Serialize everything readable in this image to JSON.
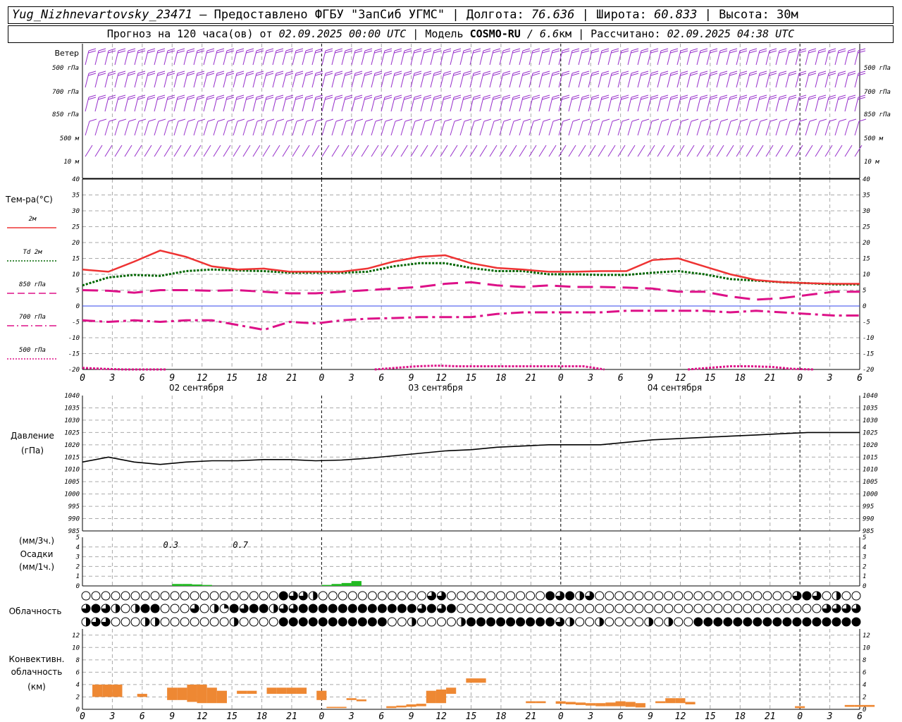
{
  "header": {
    "station": "Yug_Nizhnevartovsky_23471",
    "dash": " — ",
    "provider": "Предоставлено ФГБУ \"ЗапСиб УГМС\"",
    "sep": " | ",
    "lon_label": "Долгота: ",
    "lon": "76.636",
    "lat_label": "Широта: ",
    "lat": "60.833",
    "alt_label": "Высота: ",
    "alt": "30м",
    "forecast_prefix": "Прогноз на 120 часа(ов) от ",
    "forecast_from": "02.09.2025 00:00 UTC",
    "model_label": "  | Модель ",
    "model": "COSMO-RU",
    "model_res": " / 6.6",
    "model_res_unit": "км",
    "calc_label": " | Рассчитано: ",
    "calc_time": "02.09.2025 04:38 UTC"
  },
  "wind_panel": {
    "title": "Ветер",
    "levels": [
      "500 гПа",
      "700 гПа",
      "850 гПа",
      "500 м",
      "10 м"
    ],
    "barb_color": "#9933cc"
  },
  "time_axis": {
    "hour_labels": [
      "0",
      "3",
      "6",
      "9",
      "12",
      "15",
      "18",
      "21",
      "0",
      "3",
      "6",
      "9",
      "12",
      "15",
      "18",
      "21",
      "0",
      "3",
      "6",
      "9",
      "12",
      "15",
      "18",
      "21",
      "0",
      "3",
      "6"
    ],
    "dates": [
      "02 сентября",
      "03 сентября",
      "04 сентября"
    ]
  },
  "temperature_panel": {
    "title": "Тем-ра(°С)",
    "legend": [
      {
        "label": "2м",
        "color": "#ee3333",
        "style": "solid"
      },
      {
        "label": "Td  2м",
        "color": "#006600",
        "style": "dotted"
      },
      {
        "label": "850 гПа",
        "color": "#dd1188",
        "style": "dash"
      },
      {
        "label": "700 гПа",
        "color": "#dd1188",
        "style": "dashdot"
      },
      {
        "label": "500 гПа",
        "color": "#dd1188",
        "style": "dotted"
      }
    ],
    "yticks": [
      "40",
      "35",
      "30",
      "25",
      "20",
      "15",
      "10",
      "5",
      "0",
      "-5",
      "-10",
      "-15",
      "-20"
    ]
  },
  "pressure_panel": {
    "title": "Давление",
    "unit": "(гПа)",
    "yticks": [
      "1040",
      "1035",
      "1030",
      "1025",
      "1020",
      "1015",
      "1010",
      "1005",
      "1000",
      "995",
      "990",
      "985"
    ]
  },
  "precip_panel": {
    "unit_3h": "(мм/3ч.)",
    "title": "Осадки",
    "unit_1h": "(мм/1ч.)",
    "yticks": [
      "5",
      "4",
      "3",
      "2",
      "1",
      "0"
    ],
    "totals": [
      {
        "hour": 12,
        "text": "0.3"
      },
      {
        "hour": 27,
        "text": "0.7"
      }
    ]
  },
  "cloud_panel": {
    "title": "Облачность"
  },
  "conv_panel": {
    "title_1": "Конвективн.",
    "title_2": "облачность",
    "unit": "(км)",
    "yticks": [
      "12",
      "10",
      "8",
      "6",
      "4",
      "2",
      "0"
    ]
  },
  "chart_data": {
    "type": "line",
    "x_hours": [
      0,
      3,
      6,
      9,
      12,
      15,
      18,
      21,
      24,
      27,
      30,
      33,
      36,
      39,
      42,
      45,
      48,
      51,
      54,
      57,
      60,
      63,
      66,
      69,
      72,
      75,
      78
    ],
    "temperature": {
      "ylim": [
        -20,
        40
      ],
      "t2m": [
        11.5,
        10.8,
        14,
        17.5,
        15.5,
        12.5,
        11.5,
        11.8,
        10.8,
        10.8,
        10.8,
        11.8,
        14,
        15.5,
        16,
        13.5,
        12,
        11.5,
        10.8,
        10.8,
        11,
        11,
        14.5,
        15,
        12.5,
        10,
        8.2,
        7.5,
        7.2,
        7,
        7
      ],
      "td2m": [
        6.5,
        9,
        9.8,
        9.5,
        11,
        11.5,
        11.2,
        11,
        10.5,
        10.5,
        10.5,
        10.8,
        12.5,
        13.5,
        13.5,
        12,
        11,
        11,
        10,
        10,
        9.8,
        9.8,
        10.5,
        11,
        10,
        8.5,
        8,
        7.5,
        7.2,
        6.8,
        6.8
      ],
      "t850": [
        5,
        4.8,
        4.2,
        5,
        5,
        4.8,
        5,
        4.5,
        4,
        4,
        4.5,
        5,
        5.5,
        6,
        7,
        7.5,
        6.5,
        6,
        6.5,
        6,
        6,
        5.8,
        5.5,
        4.5,
        4.5,
        3,
        2,
        2.5,
        3.5,
        4.5,
        4.5
      ],
      "t700": [
        -4.5,
        -5,
        -4.5,
        -5,
        -4.5,
        -4.5,
        -6,
        -7.5,
        -5,
        -5.5,
        -4.5,
        -4,
        -3.8,
        -3.5,
        -3.5,
        -3.5,
        -2.5,
        -2,
        -2,
        -2,
        -2,
        -1.5,
        -1.5,
        -1.5,
        -1.5,
        -2,
        -1.5,
        -2,
        -2.5,
        -3,
        -3
      ],
      "t500_segments": [
        {
          "hours": [
            0,
            3,
            6,
            9,
            12
          ],
          "values": [
            -19.5,
            -19.8,
            -20,
            -20,
            -20
          ]
        },
        {
          "hours": [
            42,
            45,
            48,
            51,
            54,
            57,
            60,
            63,
            66,
            69,
            72,
            75
          ],
          "values": [
            -20,
            -19.5,
            -19,
            -18.8,
            -19,
            -19,
            -19,
            -19,
            -19,
            -19,
            -19,
            -20
          ]
        },
        {
          "hours": [
            87,
            90,
            93,
            96,
            99,
            102,
            105
          ],
          "values": [
            -20,
            -19.5,
            -19,
            -19,
            -19.2,
            -19.8,
            -20
          ]
        }
      ]
    },
    "pressure": {
      "ylim": [
        985,
        1040
      ],
      "values": [
        1013,
        1015,
        1013,
        1012,
        1013,
        1013.5,
        1013.5,
        1014,
        1014,
        1013.5,
        1013.8,
        1014.5,
        1015.5,
        1016.5,
        1017.5,
        1018,
        1019,
        1019.5,
        1020,
        1020,
        1020,
        1021,
        1022,
        1022.5,
        1023,
        1023.5,
        1024,
        1024.5,
        1025,
        1025,
        1025
      ]
    },
    "precipitation": {
      "ylim": [
        0,
        5
      ],
      "bars_mm_per_hour": [
        {
          "hour": 9,
          "value": 0.2
        },
        {
          "hour": 10,
          "value": 0.2
        },
        {
          "hour": 11,
          "value": 0.15
        },
        {
          "hour": 12,
          "value": 0.1
        },
        {
          "hour": 24,
          "value": 0.1
        },
        {
          "hour": 25,
          "value": 0.2
        },
        {
          "hour": 26,
          "value": 0.3
        },
        {
          "hour": 27,
          "value": 0.5
        }
      ]
    },
    "convective_cloud_km": {
      "ylim": [
        0,
        13
      ],
      "layers": [
        {
          "hour": 0.5,
          "base": 2.0,
          "top": 4.0
        },
        {
          "hour": 1.5,
          "base": 2.0,
          "top": 4.0
        },
        {
          "hour": 2.5,
          "base": 2.0,
          "top": 4.0
        },
        {
          "hour": 5,
          "base": 2.0,
          "top": 2.5
        },
        {
          "hour": 8,
          "base": 1.5,
          "top": 3.5
        },
        {
          "hour": 9,
          "base": 1.5,
          "top": 3.5
        },
        {
          "hour": 10,
          "base": 1.2,
          "top": 4.0
        },
        {
          "hour": 11,
          "base": 1.0,
          "top": 4.0
        },
        {
          "hour": 12,
          "base": 1.0,
          "top": 3.5
        },
        {
          "hour": 13,
          "base": 1.0,
          "top": 3.0
        },
        {
          "hour": 15,
          "base": 2.5,
          "top": 3.0
        },
        {
          "hour": 16,
          "base": 2.5,
          "top": 3.0
        },
        {
          "hour": 18,
          "base": 2.5,
          "top": 3.5
        },
        {
          "hour": 19,
          "base": 2.5,
          "top": 3.5
        },
        {
          "hour": 20,
          "base": 2.5,
          "top": 3.5
        },
        {
          "hour": 21,
          "base": 2.5,
          "top": 3.5
        },
        {
          "hour": 23,
          "base": 1.5,
          "top": 3.0
        },
        {
          "hour": 24,
          "base": 0.2,
          "top": 0.4
        },
        {
          "hour": 25,
          "base": 0.2,
          "top": 0.4
        },
        {
          "hour": 26,
          "base": 1.5,
          "top": 1.8
        },
        {
          "hour": 27,
          "base": 1.3,
          "top": 1.6
        },
        {
          "hour": 30,
          "base": 0.2,
          "top": 0.5
        },
        {
          "hour": 31,
          "base": 0.3,
          "top": 0.6
        },
        {
          "hour": 32,
          "base": 0.4,
          "top": 0.8
        },
        {
          "hour": 33,
          "base": 0.5,
          "top": 0.9
        },
        {
          "hour": 34,
          "base": 1.0,
          "top": 3.0
        },
        {
          "hour": 35,
          "base": 1.0,
          "top": 3.2
        },
        {
          "hour": 36,
          "base": 2.5,
          "top": 3.5
        },
        {
          "hour": 38,
          "base": 4.3,
          "top": 5.0
        },
        {
          "hour": 39,
          "base": 4.3,
          "top": 5.0
        },
        {
          "hour": 44,
          "base": 1.0,
          "top": 1.3
        },
        {
          "hour": 45,
          "base": 1.0,
          "top": 1.3
        },
        {
          "hour": 47,
          "base": 0.9,
          "top": 1.3
        },
        {
          "hour": 48,
          "base": 0.8,
          "top": 1.2
        },
        {
          "hour": 49,
          "base": 0.7,
          "top": 1.1
        },
        {
          "hour": 50,
          "base": 0.6,
          "top": 1.0
        },
        {
          "hour": 51,
          "base": 0.5,
          "top": 1.0
        },
        {
          "hour": 52,
          "base": 0.5,
          "top": 1.1
        },
        {
          "hour": 53,
          "base": 0.5,
          "top": 1.3
        },
        {
          "hour": 54,
          "base": 0.4,
          "top": 1.2
        },
        {
          "hour": 55,
          "base": 0.3,
          "top": 1.0
        },
        {
          "hour": 57,
          "base": 1.0,
          "top": 1.3
        },
        {
          "hour": 58,
          "base": 1.0,
          "top": 1.8
        },
        {
          "hour": 59,
          "base": 1.0,
          "top": 1.8
        },
        {
          "hour": 60,
          "base": 0.8,
          "top": 1.2
        },
        {
          "hour": 71,
          "base": 0.2,
          "top": 0.5
        },
        {
          "hour": 76,
          "base": 0.4,
          "top": 0.7
        },
        {
          "hour": 77,
          "base": 0.4,
          "top": 0.7
        },
        {
          "hour": 78,
          "base": 0.4,
          "top": 0.7
        }
      ]
    },
    "cloudiness_octas": {
      "rows": [
        "upper",
        "middle",
        "lower"
      ],
      "upper": [
        0,
        0,
        0,
        0,
        0,
        0,
        0,
        0,
        0,
        0,
        0,
        0,
        0,
        0,
        0,
        0,
        0,
        0,
        0,
        0,
        0,
        0,
        0,
        0,
        0,
        0,
        2,
        0,
        0,
        0,
        0,
        0,
        8,
        6,
        6,
        6,
        4,
        0,
        0,
        0,
        0,
        0,
        0,
        0,
        0,
        0,
        0,
        0,
        0,
        0,
        0,
        0,
        0,
        0,
        0,
        0,
        6,
        6,
        0,
        0,
        0,
        0,
        0,
        0,
        0,
        0,
        0,
        0,
        0,
        0,
        0,
        0,
        0,
        0,
        0,
        8,
        6,
        6,
        8,
        8,
        4,
        6,
        4,
        0,
        0,
        0,
        0,
        0,
        0,
        0,
        0,
        0,
        0,
        0,
        0,
        0,
        0,
        0,
        0,
        0,
        0,
        0,
        0,
        0,
        0,
        0,
        0,
        0,
        0,
        0,
        0,
        0,
        0,
        0,
        0,
        6,
        6,
        8,
        6,
        2,
        0,
        0,
        4,
        0,
        4,
        0,
        0
      ],
      "middle": [
        6,
        8,
        8,
        6,
        4,
        2,
        0,
        6,
        4,
        8,
        8,
        8,
        4,
        0,
        0,
        0,
        0,
        6,
        0,
        0,
        6,
        4,
        2,
        8,
        8,
        8,
        6,
        8,
        8,
        8,
        8,
        4,
        6,
        4,
        6,
        8,
        8,
        8,
        8,
        8,
        8,
        8,
        8,
        8,
        8,
        8,
        8,
        8,
        8,
        8,
        8,
        8,
        8,
        8,
        8,
        6,
        4,
        8,
        6,
        4,
        8,
        6,
        0,
        0,
        0,
        0,
        0,
        0,
        0,
        0,
        0,
        0,
        0,
        0,
        0,
        0,
        0,
        0,
        0,
        0,
        0,
        0,
        0,
        0,
        0,
        0,
        0,
        0,
        0,
        0,
        0,
        0,
        0,
        0,
        0,
        0,
        0,
        0,
        0,
        0,
        0,
        0,
        0,
        0,
        0,
        0,
        0,
        0,
        0,
        0,
        0,
        0,
        0,
        0,
        0,
        0,
        0,
        0,
        0,
        0,
        0,
        0,
        6,
        4,
        6,
        6,
        2,
        6,
        4
      ],
      "lower": [
        4,
        6,
        4,
        6,
        0,
        4,
        0,
        4,
        0,
        4,
        0,
        4,
        0,
        0,
        0,
        0,
        0,
        0,
        0,
        0,
        0,
        0,
        0,
        0,
        4,
        0,
        0,
        0,
        0,
        0,
        4,
        0,
        8,
        8,
        8,
        8,
        8,
        8,
        8,
        8,
        8,
        8,
        8,
        8,
        8,
        8,
        8,
        8,
        8,
        4,
        0,
        4,
        0,
        4,
        0,
        0,
        4,
        0,
        0,
        0,
        0,
        0,
        4,
        8,
        8,
        8,
        8,
        8,
        8,
        8,
        8,
        8,
        8,
        8,
        8,
        8,
        8,
        8,
        6,
        0,
        4,
        0,
        4,
        0,
        4,
        0,
        0,
        0,
        0,
        0,
        4,
        0,
        0,
        4,
        0,
        0,
        4,
        0,
        0,
        0,
        0,
        8,
        8,
        8,
        8,
        8,
        8,
        8,
        8,
        8,
        8,
        8,
        8,
        8,
        8,
        8,
        8,
        8,
        8,
        8,
        8,
        8,
        8,
        8,
        8,
        8,
        8,
        8,
        8
      ]
    }
  }
}
